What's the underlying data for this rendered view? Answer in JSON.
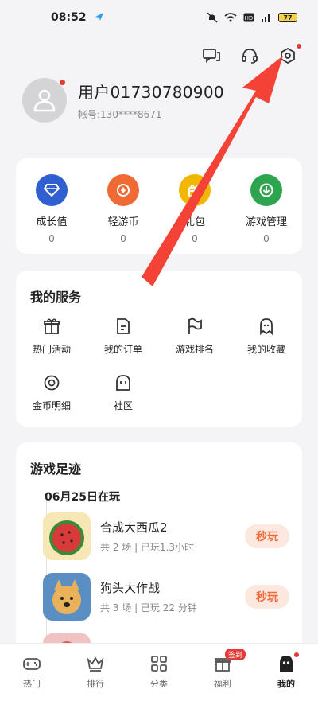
{
  "status_bar": {
    "time": "08:52",
    "battery": "77"
  },
  "profile": {
    "username": "用户01730780900",
    "account": "帐号:130****8671"
  },
  "wallet": [
    {
      "label": "成长值",
      "value": "0",
      "color": "#2f5fd0",
      "icon": "diamond-icon"
    },
    {
      "label": "轻游币",
      "value": "0",
      "color": "#f06a35",
      "icon": "coin-icon"
    },
    {
      "label": "礼包",
      "value": "0",
      "color": "#f2b705",
      "icon": "gift-pack-icon"
    },
    {
      "label": "游戏管理",
      "value": "0",
      "color": "#2da44e",
      "icon": "download-icon"
    }
  ],
  "services": {
    "title": "我的服务",
    "items": [
      {
        "label": "热门活动",
        "icon": "gift-icon"
      },
      {
        "label": "我的订单",
        "icon": "order-icon"
      },
      {
        "label": "游戏排名",
        "icon": "flag-icon"
      },
      {
        "label": "我的收藏",
        "icon": "ghost-icon"
      },
      {
        "label": "金币明细",
        "icon": "coin-detail-icon"
      },
      {
        "label": "社区",
        "icon": "community-icon"
      }
    ]
  },
  "history": {
    "title": "游戏足迹",
    "date": "06月25日在玩",
    "games": [
      {
        "name": "合成大西瓜2",
        "meta": "共 2 场 | 已玩1.3小时",
        "button": "秒玩"
      },
      {
        "name": "狗头大作战",
        "meta": "共 3 场 | 已玩 22 分钟",
        "button": "秒玩"
      }
    ]
  },
  "nav": [
    {
      "label": "热门",
      "icon": "gamepad-icon"
    },
    {
      "label": "排行",
      "icon": "crown-icon"
    },
    {
      "label": "分类",
      "icon": "grid-icon"
    },
    {
      "label": "福利",
      "icon": "gift-icon",
      "badge": "签到"
    },
    {
      "label": "我的",
      "icon": "ghost-icon",
      "active": true
    }
  ],
  "colors": {
    "accent_red": "#e53935",
    "play_button_bg": "#fde8df",
    "play_button_text": "#ef6a3a"
  }
}
